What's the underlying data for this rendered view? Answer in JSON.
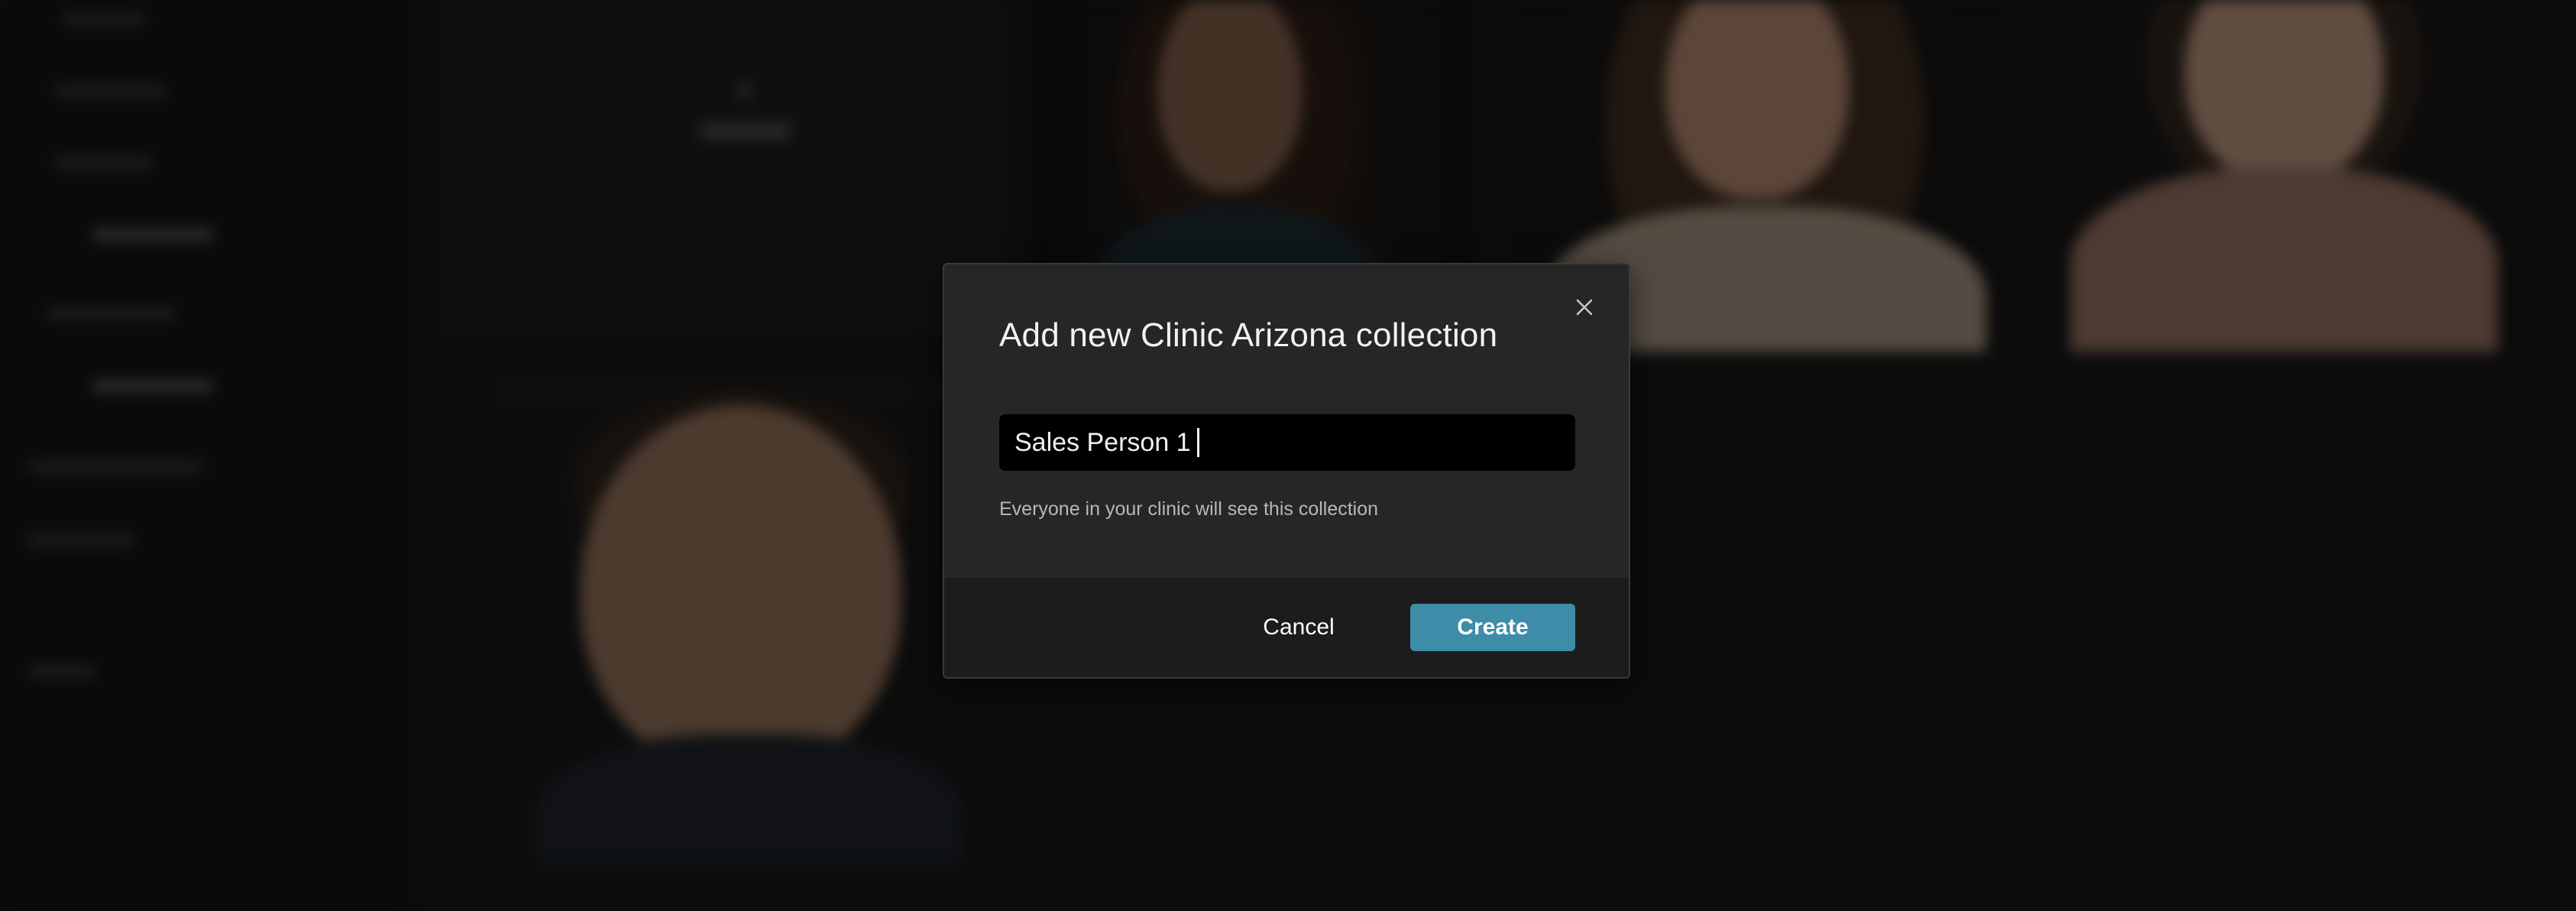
{
  "modal": {
    "title": "Add new Clinic Arizona collection",
    "input_value": "Sales Person 1",
    "helper_text": "Everyone in your clinic will see this collection",
    "cancel_label": "Cancel",
    "create_label": "Create",
    "close_icon": "close-icon"
  },
  "colors": {
    "accent": "#3d8ca8",
    "modal_bg": "#262626",
    "footer_bg": "#1c1c1c",
    "input_bg": "#000000"
  }
}
